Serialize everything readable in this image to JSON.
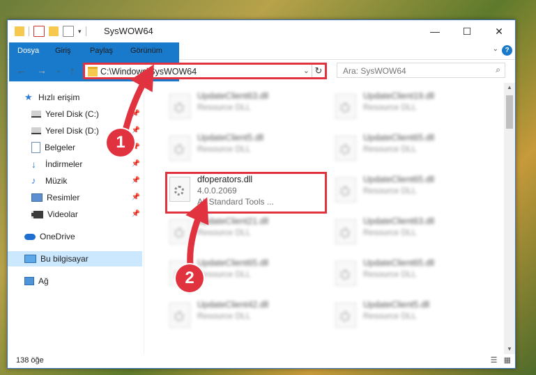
{
  "window": {
    "title": "SysWOW64",
    "controls": {
      "minimize": "—",
      "maximize": "☐",
      "close": "✕"
    }
  },
  "ribbon": {
    "tabs": [
      "Dosya",
      "Giriş",
      "Paylaş",
      "Görünüm"
    ],
    "help": "?"
  },
  "nav": {
    "address_path": "C:\\Windows\\SysWOW64",
    "search_placeholder": "Ara: SysWOW64"
  },
  "sidebar": {
    "items": [
      {
        "label": "Hızlı erişim",
        "icon": "star-icon"
      },
      {
        "label": "Yerel Disk (C:)",
        "icon": "drive-icon"
      },
      {
        "label": "Yerel Disk (D:)",
        "icon": "drive-icon"
      },
      {
        "label": "Belgeler",
        "icon": "documents-icon"
      },
      {
        "label": "İndirmeler",
        "icon": "download-arrow-icon"
      },
      {
        "label": "Müzik",
        "icon": "music-note-icon"
      },
      {
        "label": "Resimler",
        "icon": "pictures-icon"
      },
      {
        "label": "Videolar",
        "icon": "video-icon"
      },
      {
        "label": "OneDrive",
        "icon": "cloud-icon"
      },
      {
        "label": "Bu bilgisayar",
        "icon": "computer-icon"
      },
      {
        "label": "Ağ",
        "icon": "network-icon"
      }
    ],
    "selected": "Bu bilgisayar"
  },
  "files": {
    "left": [
      {
        "name": "UpdateClient63.dll",
        "desc": "Resource DLL"
      },
      {
        "name": "UpdateClient5.dll",
        "desc": "Resource DLL"
      },
      {
        "name": "dfoperators.dll",
        "version": "4.0.0.2069",
        "desc": "All Standard Tools ..."
      },
      {
        "name": "UpdateClient21.dll",
        "desc": "Resource DLL"
      },
      {
        "name": "UpdateClient65.dll",
        "desc": "Resource DLL"
      },
      {
        "name": "UpdateClient42.dll",
        "desc": "Resource DLL"
      }
    ],
    "right": [
      {
        "name": "UpdateClient19.dll",
        "desc": "Resource DLL"
      },
      {
        "name": "UpdateClient65.dll",
        "desc": "Resource DLL"
      },
      {
        "name": "UpdateClient65.dll",
        "desc": "Resource DLL"
      },
      {
        "name": "UpdateClient63.dll",
        "desc": "Resource DLL"
      },
      {
        "name": "UpdateClient65.dll",
        "desc": "Resource DLL"
      },
      {
        "name": "UpdateClient5.dll",
        "desc": "Resource DLL"
      }
    ]
  },
  "status": {
    "count": "138 öğe"
  },
  "annotations": {
    "step1": "1",
    "step2": "2",
    "color": "#e0333f"
  }
}
